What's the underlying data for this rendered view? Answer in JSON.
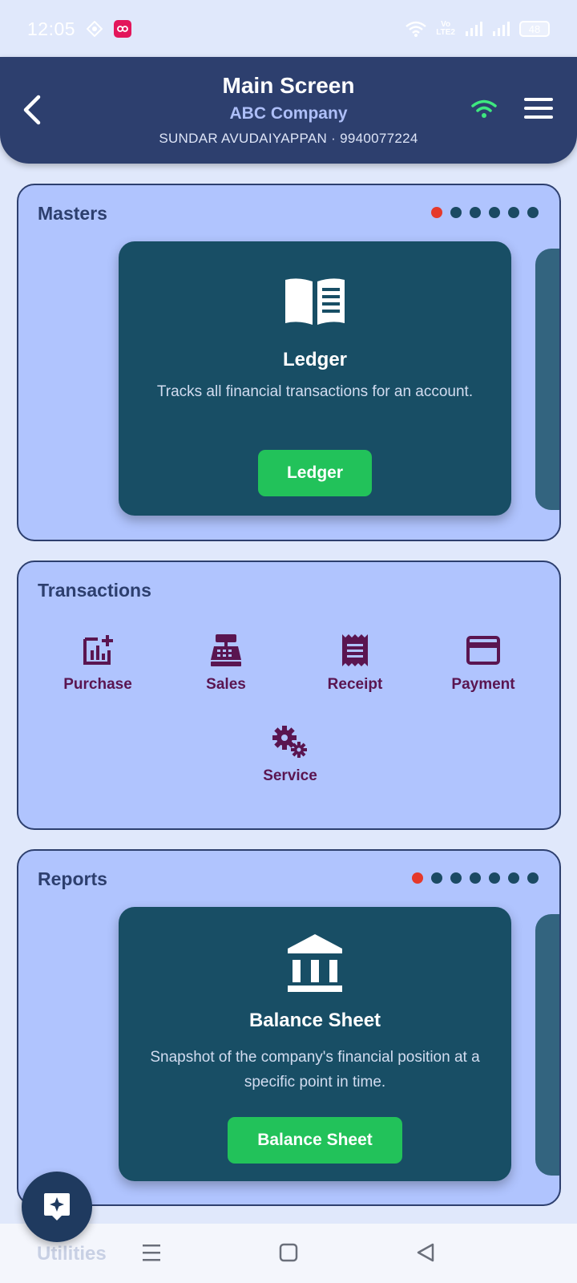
{
  "status_bar": {
    "time": "12:05",
    "lte_top": "Vo",
    "lte_bottom": "LTE2",
    "battery": "48"
  },
  "header": {
    "title": "Main Screen",
    "company": "ABC Company",
    "user": "SUNDAR AVUDAIYAPPAN · 9940077224",
    "wifi_color": "#3ee87f"
  },
  "masters": {
    "title": "Masters",
    "slide": {
      "icon": "book-open-icon",
      "title": "Ledger",
      "description": "Tracks all financial transactions for an account.",
      "button_label": "Ledger"
    }
  },
  "transactions": {
    "title": "Transactions",
    "items": [
      {
        "label": "Purchase",
        "icon": "add-chart-icon"
      },
      {
        "label": "Sales",
        "icon": "cash-register-icon"
      },
      {
        "label": "Receipt",
        "icon": "receipt-icon"
      },
      {
        "label": "Payment",
        "icon": "credit-card-icon"
      },
      {
        "label": "Service",
        "icon": "gears-icon"
      }
    ]
  },
  "reports": {
    "title": "Reports",
    "slide": {
      "icon": "bank-building-icon",
      "title": "Balance Sheet",
      "description": "Snapshot of the company's financial position at a specific point in time.",
      "button_label": "Balance Sheet"
    }
  },
  "utilities": {
    "title": "Utilities"
  },
  "colors": {
    "header_bg": "#2d3f6e",
    "card_bg": "#b0c4fe",
    "slide_bg": "#184e65",
    "button_green": "#22c25a",
    "dot_active": "#e5392b",
    "transaction_icon": "#5a1550"
  }
}
